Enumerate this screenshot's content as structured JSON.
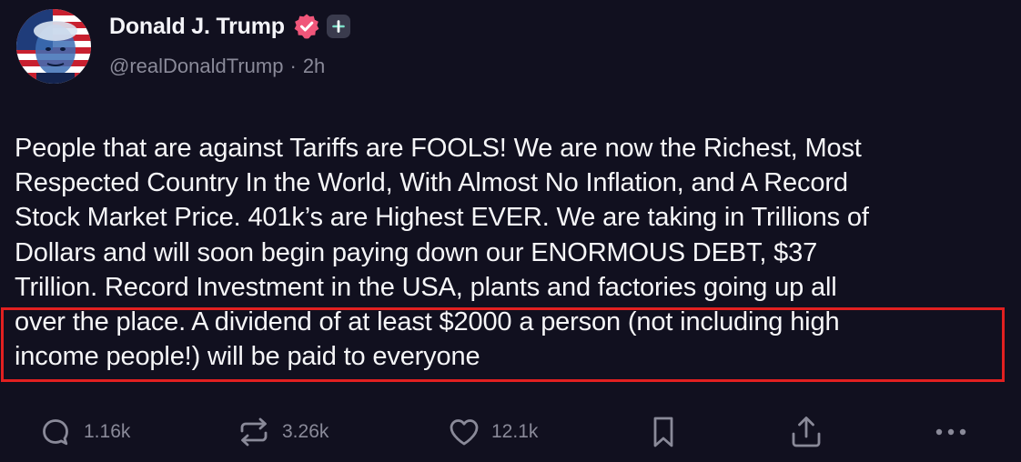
{
  "post": {
    "display_name": "Donald J. Trump",
    "handle": "@realDonaldTrump",
    "separator": "·",
    "time_ago": "2h",
    "text": "People that are against Tariffs are FOOLS! We are now the Richest, Most\nRespected Country In the World, With Almost No Inflation, and A Record\nStock Market Price. 401k’s are Highest EVER. We are taking in Trillions of\nDollars and will soon begin paying down our ENORMOUS DEBT, $37\nTrillion. Record Investment in the USA, plants and factories going up all\nover the place. A dividend of at least $2000 a person (not including high\nincome people!) will be paid to everyone"
  },
  "actions": {
    "replies": "1.16k",
    "reposts": "3.26k",
    "likes": "12.1k"
  },
  "colors": {
    "background": "#11101f",
    "highlight_border": "#e22020",
    "verified_badge": "#f0567a",
    "muted_text": "#8a8a99"
  },
  "icons": [
    "avatar",
    "verified-badge-icon",
    "plus-icon",
    "reply-icon",
    "repost-icon",
    "like-icon",
    "bookmark-icon",
    "share-icon",
    "more-icon"
  ]
}
